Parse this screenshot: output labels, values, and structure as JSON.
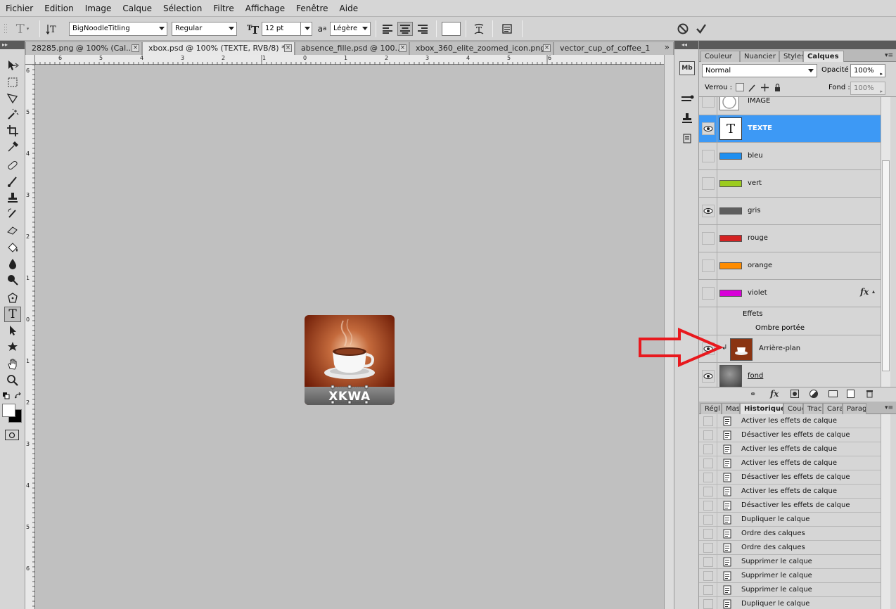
{
  "menu": [
    "Fichier",
    "Edition",
    "Image",
    "Calque",
    "Sélection",
    "Filtre",
    "Affichage",
    "Fenêtre",
    "Aide"
  ],
  "options": {
    "font_family": "BigNoodleTitling",
    "font_style": "Regular",
    "font_size": "12 pt",
    "aa_label": "a",
    "aa_label2": "a",
    "antialias": "Légère"
  },
  "doc_tabs": [
    "28285.png @ 100% (Cal...",
    "xbox.psd @ 100% (TEXTE, RVB/8) *",
    "absence_fille.psd @ 100...",
    "xbox_360_elite_zoomed_icon.png",
    "vector_cup_of_coffee_1"
  ],
  "ruler_h": [
    "6",
    "5",
    "4",
    "3",
    "2",
    "1",
    "0",
    "1",
    "2",
    "3",
    "4",
    "5",
    "6"
  ],
  "ruler_v": [
    "6",
    "5",
    "4",
    "3",
    "2",
    "1",
    "0",
    "1",
    "2",
    "3",
    "4",
    "5",
    "6"
  ],
  "canvas_text": "XKWA",
  "layers_panel": {
    "tabs": [
      "Couleur",
      "Nuancier",
      "Styles",
      "Calques"
    ],
    "blend_mode": "Normal",
    "opacity_label": "Opacité :",
    "opacity": "100%",
    "lock_label": "Verrou :",
    "fill_label": "Fond :",
    "fill": "100%",
    "layers": [
      {
        "name": "IMAGE",
        "visible": false,
        "swatch": ""
      },
      {
        "name": "TEXTE",
        "visible": true,
        "swatch": "",
        "selected": true
      },
      {
        "name": "bleu",
        "visible": false,
        "swatch": "#1e8ff0"
      },
      {
        "name": "vert",
        "visible": false,
        "swatch": "#9ccc1e"
      },
      {
        "name": "gris",
        "visible": true,
        "swatch": "#5e5e5e"
      },
      {
        "name": "rouge",
        "visible": false,
        "swatch": "#d42222"
      },
      {
        "name": "orange",
        "visible": false,
        "swatch": "#ff8c00"
      },
      {
        "name": "violet",
        "visible": false,
        "swatch": "#d800d8"
      }
    ],
    "effects_label": "Effets",
    "effect_item": "Ombre portée",
    "fx_label": "fx",
    "background_layer": "Arrière-plan",
    "fond_layer": "fond"
  },
  "history_panel": {
    "tabs": [
      "Régl",
      "Masq",
      "Historique",
      "Couc",
      "Trac",
      "Cara",
      "Parag"
    ],
    "items": [
      "Activer les effets de calque",
      "Désactiver les effets de calque",
      "Activer les effets de calque",
      "Activer les effets de calque",
      "Désactiver les effets de calque",
      "Activer les effets de calque",
      "Désactiver les effets de calque",
      "Dupliquer le calque",
      "Ordre des calques",
      "Ordre des calques",
      "Supprimer le calque",
      "Supprimer le calque",
      "Supprimer le calque",
      "Dupliquer le calque"
    ]
  },
  "colors": {
    "selection_blue": "#3d99f5",
    "arrow_red": "#e8191e",
    "canvas_gray": "#c0c0c0"
  }
}
